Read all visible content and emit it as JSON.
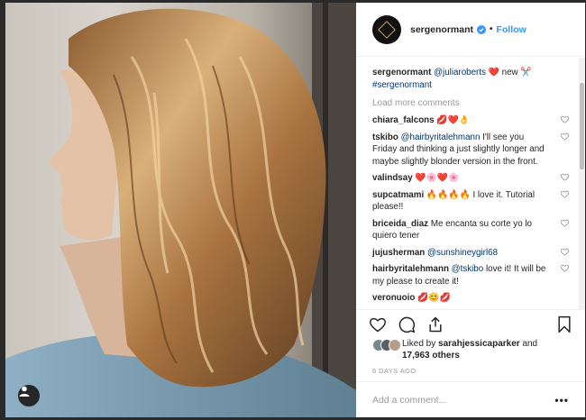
{
  "post": {
    "username": "sergenormant",
    "follow_label": "Follow",
    "separator": "•"
  },
  "caption": {
    "username": "sergenormant",
    "mention": "@juliaroberts",
    "text": "new",
    "hashtag": "#sergenormant"
  },
  "load_more_label": "Load more comments",
  "comments": [
    {
      "username": "chiara_falcons",
      "mention": "",
      "text": "",
      "emoji": "💋❤️👌"
    },
    {
      "username": "tskibo",
      "mention": "@hairbyritalehmann",
      "text": "I'll see you Friday and thinking a just slightly longer and maybe slightly blonder version in the front.",
      "emoji": ""
    },
    {
      "username": "valindsay",
      "mention": "",
      "text": "",
      "emoji": "❤️🌸❤️🌸"
    },
    {
      "username": "supcatmami",
      "mention": "",
      "text": "I love it. Tutorial please!!",
      "emoji": "🔥🔥🔥🔥"
    },
    {
      "username": "briceida_diaz",
      "mention": "",
      "text": "Me encanta su corte yo lo quiero tener",
      "emoji": ""
    },
    {
      "username": "jujusherman",
      "mention": "@sunshineygirl68",
      "text": "",
      "emoji": ""
    },
    {
      "username": "hairbyritalehmann",
      "mention": "@tskibo",
      "text": "love it! It will be my please to create it!",
      "emoji": ""
    },
    {
      "username": "veronuoio",
      "mention": "",
      "text": "",
      "emoji": "💋😊💋"
    }
  ],
  "likes": {
    "prefix": "Liked by",
    "user": "sarahjessicaparker",
    "conjunction": "and",
    "count": "17,963 others"
  },
  "timestamp": "6 DAYS AGO",
  "add_comment": {
    "placeholder": "Add a comment...",
    "more_label": "•••"
  },
  "colors": {
    "follow_blue": "#3897f0",
    "verified_blue": "#3897f0",
    "gold": "#c9a460"
  }
}
